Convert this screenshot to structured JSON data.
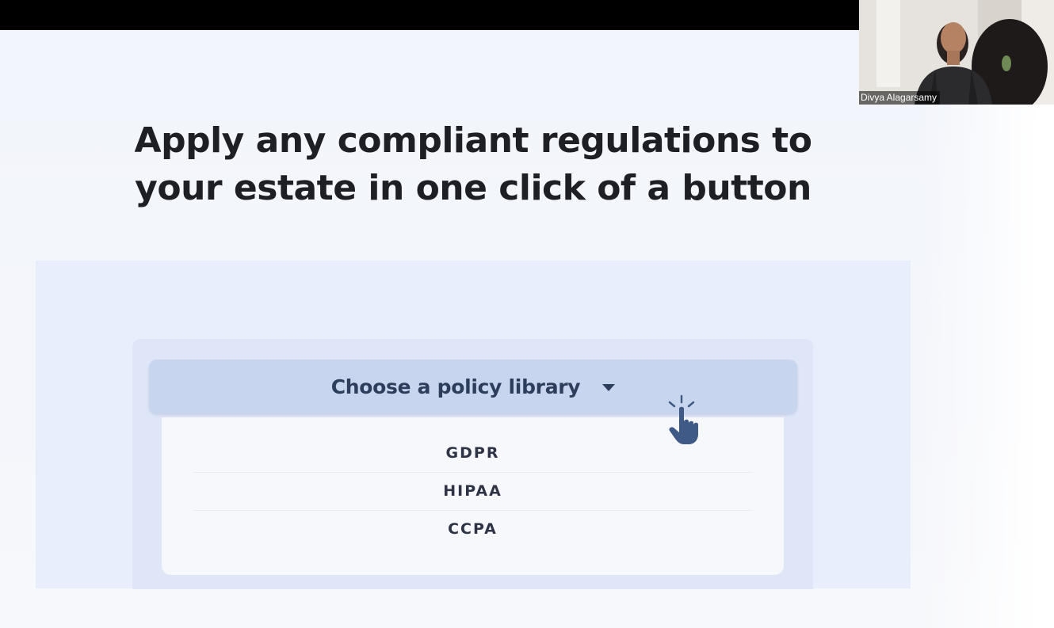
{
  "slide": {
    "headline_line1": "Apply any compliant regulations to",
    "headline_line2": "your estate in one click of a button"
  },
  "dropdown": {
    "label": "Choose a policy library",
    "options": [
      "GDPR",
      "HIPAA",
      "CCPA"
    ]
  },
  "video_tile": {
    "participant_name": "Divya Alagarsamy"
  },
  "colors": {
    "headline": "#1e1f24",
    "panel": "#e8eefb",
    "dropdown_button": "#c8d5ee",
    "dropdown_text": "#2d3e5c",
    "pointer": "#3f5a86"
  },
  "icons": {
    "caret": "caret-down-icon",
    "pointer": "hand-pointer-icon"
  }
}
